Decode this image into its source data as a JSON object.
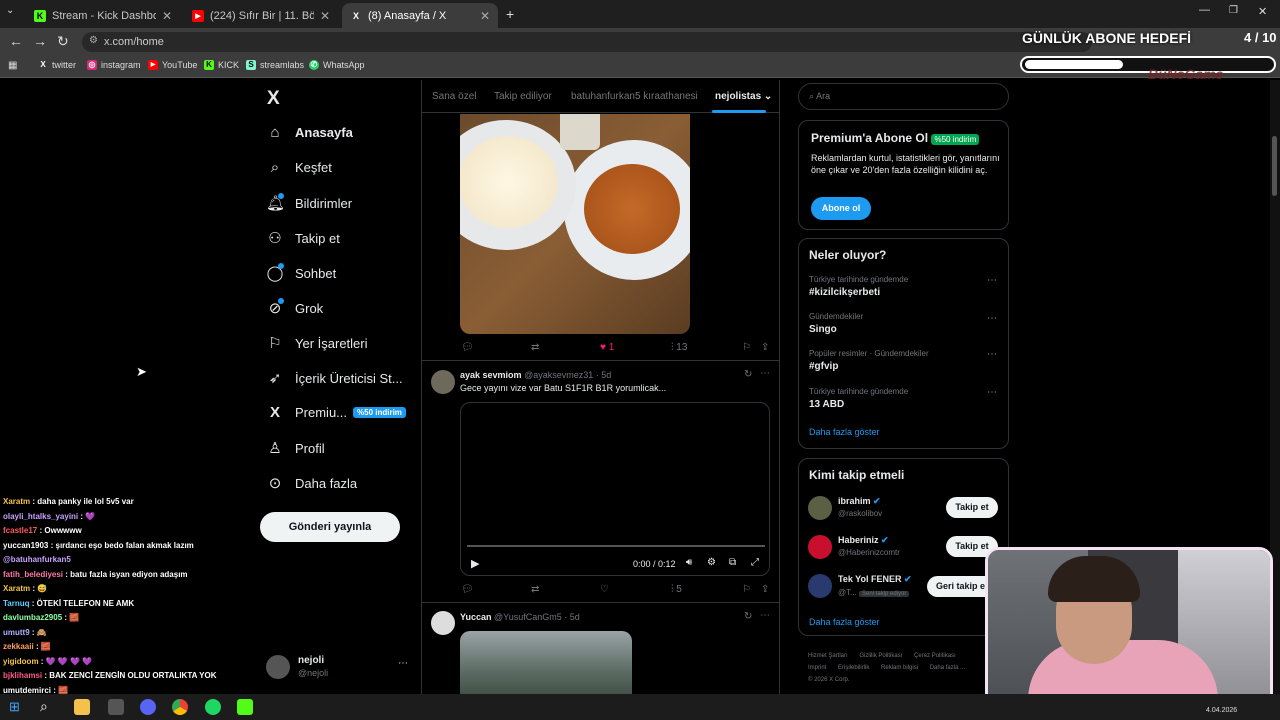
{
  "browser": {
    "tabs": [
      {
        "title": "Stream - Kick Dashboard",
        "icon": "kick-icon"
      },
      {
        "title": "(224) Sıfır Bir | 11. Bölüm - YouT",
        "icon": "youtube-icon"
      },
      {
        "title": "(8) Anasayfa / X",
        "icon": "x-icon"
      }
    ],
    "url": "x.com/home",
    "bookmarks": [
      "twitter",
      "instagram",
      "YouTube",
      "KICK",
      "streamlabs",
      "WhatsApp"
    ]
  },
  "overlay": {
    "goal_title": "GÜNLÜK ABONE HEDEFİ",
    "goal_count": "4 / 10",
    "goal_progress": 0.4
  },
  "x_nav": {
    "items": [
      {
        "label": "Anasayfa",
        "icon": "home-icon"
      },
      {
        "label": "Keşfet",
        "icon": "search-icon"
      },
      {
        "label": "Bildirimler",
        "icon": "bell-icon"
      },
      {
        "label": "Takip et",
        "icon": "follow-icon"
      },
      {
        "label": "Sohbet",
        "icon": "chat-icon"
      },
      {
        "label": "Grok",
        "icon": "grok-icon"
      },
      {
        "label": "Yer İşaretleri",
        "icon": "bookmark-icon"
      },
      {
        "label": "İçerik Üreticisi St...",
        "icon": "rocket-icon"
      },
      {
        "label": "Premiu...",
        "icon": "x-logo-icon"
      },
      {
        "label": "Profil",
        "icon": "profile-icon"
      },
      {
        "label": "Daha fazla",
        "icon": "more-icon"
      }
    ],
    "premium_badge": "%50 indirim",
    "post_button": "Gönderi yayınla",
    "account_name": "nejoli",
    "account_handle": "@nejoli"
  },
  "feed": {
    "tabs": [
      "Sana özel",
      "Takip ediliyor",
      "batuhanfurkan5 kıraathanesi",
      "nejolistas"
    ],
    "post1": {
      "likes": "1",
      "views": "13"
    },
    "post2": {
      "name": "ayak sevmiom",
      "handle": "@ayaksevmez31 · 5d",
      "text": "Gece yayını vize var Batu S1F1R B1R yorumlicak...",
      "video_time": "0:00 / 0:12",
      "views": "5"
    },
    "post3": {
      "name": "Yuccan",
      "handle": "@YusufCanGm5 · 5d"
    }
  },
  "right": {
    "search_placeholder": "Ara",
    "premium": {
      "title": "Premium'a Abone Ol",
      "badge": "%50 indirim",
      "text": "Reklamlardan kurtul, istatistikleri gör, yanıtlarını öne çıkar ve 20'den fazla özelliğin kilidini aç.",
      "button": "Abone ol"
    },
    "trends": {
      "title": "Neler oluyor?",
      "items": [
        {
          "context": "Türkiye tarihinde gündemde",
          "name": "#kizilcikşerbeti"
        },
        {
          "context": "Gündemdekiler",
          "name": "Singo"
        },
        {
          "context": "Popüler resimler · Gündemdekiler",
          "name": "#gfvip"
        },
        {
          "context": "Türkiye tarihinde gündemde",
          "name": "13 ABD"
        }
      ],
      "more": "Daha fazla göster"
    },
    "who_to_follow": {
      "title": "Kimi takip etmeli",
      "items": [
        {
          "name": "ibrahim",
          "handle": "@raskolibov",
          "button": "Takip et"
        },
        {
          "name": "Haberiniz",
          "handle": "@Haberinizcomtr",
          "button": "Takip et"
        },
        {
          "name": "Tek Yol FENER",
          "handle": "@T...",
          "tag": "Seni takip ediyor",
          "button": "Geri takip et"
        }
      ],
      "more": "Daha fazla göster"
    },
    "footer": [
      "Hizmet Şartları",
      "Gizlilik Politikası",
      "Çerez Politikası",
      "Imprint",
      "Erişilebilirlik",
      "Reklam bilgisi",
      "Daha fazla ...",
      "© 2026 X Corp."
    ]
  },
  "chat": [
    {
      "user": "Xaratm",
      "msg": ": daha panky ile lol 5v5 var",
      "color": "#f5c542"
    },
    {
      "user": "olayli_htalks_yayini",
      "msg": ": 💜",
      "color": "#c8a2ff"
    },
    {
      "user": "fcastle17",
      "msg": ": Owwwww",
      "color": "#ff5a5a"
    },
    {
      "user": "yuccan1903",
      "msg": ": şırdancı eşo bedo falan akmak lazım",
      "color": "#ffffff"
    },
    {
      "user": "@batuhanfurkan5",
      "msg": "",
      "color": "#c8a2ff"
    },
    {
      "user": "fatih_belediyesi",
      "msg": ": batu fazla isyan ediyon adaşım",
      "color": "#ff7aa8"
    },
    {
      "user": "Xaratm",
      "msg": ": 😅",
      "color": "#f5c542"
    },
    {
      "user": "Tarnuq",
      "msg": ": ÖTEKİ TELEFON NE AMK",
      "color": "#5ad1ff"
    },
    {
      "user": "davlumbaz2905",
      "msg": ": 🧱",
      "color": "#8effa0"
    },
    {
      "user": "umutt9",
      "msg": ": 🙈",
      "color": "#b0b0ff"
    },
    {
      "user": "zekkaaii",
      "msg": ": 🧱",
      "color": "#ff9f5a"
    },
    {
      "user": "yigidoom",
      "msg": ": 💜 💜 💜 💜",
      "color": "#f5c542"
    },
    {
      "user": "bjklihamsi",
      "msg": ": BAK ZENCİ ZENGİN OLDU ORTALIKTA YOK",
      "color": "#ff5a8a"
    },
    {
      "user": "umutdemirci",
      "msg": ": 🧱",
      "color": "#ffffff"
    }
  ],
  "taskbar": {
    "date": "4.04.2026"
  }
}
